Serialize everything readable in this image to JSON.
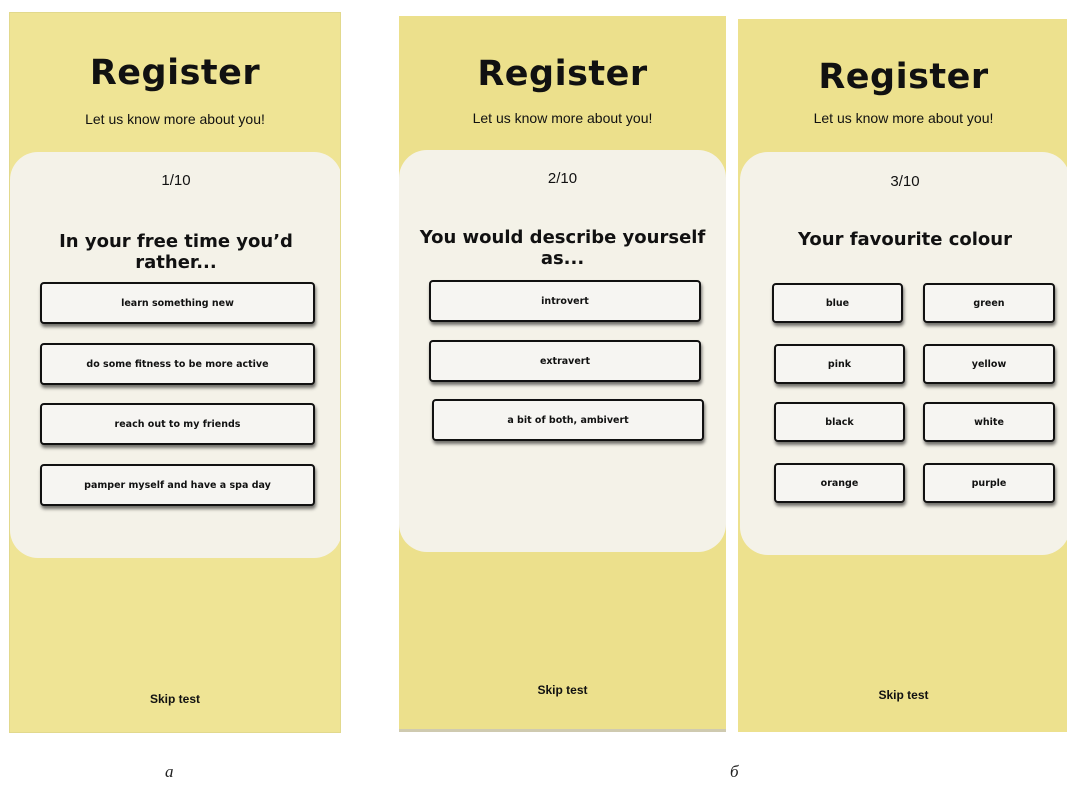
{
  "screens": [
    {
      "title": "Register",
      "subtitle": "Let us know more about you!",
      "progress": "1/10",
      "question_line1": "In your free time you’d",
      "question_line2": "rather...",
      "options": [
        "learn something new",
        "do some fitness to be more active",
        "reach out to my friends",
        "pamper myself and have a spa day"
      ],
      "skip": "Skip test"
    },
    {
      "title": "Register",
      "subtitle": "Let us know more about you!",
      "progress": "2/10",
      "question_line1": "You would describe yourself",
      "question_line2": "as...",
      "options": [
        "introvert",
        "extravert",
        "a bit of both, ambivert"
      ],
      "skip": "Skip test"
    },
    {
      "title": "Register",
      "subtitle": "Let us know more about you!",
      "progress": "3/10",
      "question": "Your favourite colour",
      "options": [
        "blue",
        "green",
        "pink",
        "yellow",
        "black",
        "white",
        "orange",
        "purple"
      ],
      "skip": "Skip test"
    }
  ],
  "captions": [
    "a",
    "б"
  ]
}
